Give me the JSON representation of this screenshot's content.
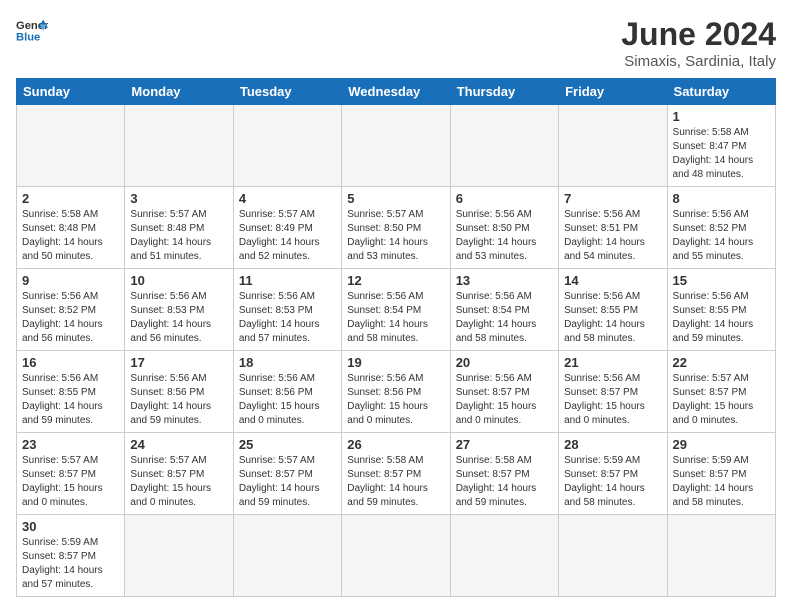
{
  "header": {
    "logo_general": "General",
    "logo_blue": "Blue",
    "month_title": "June 2024",
    "location": "Simaxis, Sardinia, Italy"
  },
  "days_of_week": [
    "Sunday",
    "Monday",
    "Tuesday",
    "Wednesday",
    "Thursday",
    "Friday",
    "Saturday"
  ],
  "weeks": [
    [
      {
        "day": null,
        "empty": true
      },
      {
        "day": null,
        "empty": true
      },
      {
        "day": null,
        "empty": true
      },
      {
        "day": null,
        "empty": true
      },
      {
        "day": null,
        "empty": true
      },
      {
        "day": null,
        "empty": true
      },
      {
        "day": 1,
        "sunrise": "5:58 AM",
        "sunset": "8:47 PM",
        "daylight": "14 hours and 48 minutes."
      }
    ],
    [
      {
        "day": 2,
        "sunrise": "5:58 AM",
        "sunset": "8:48 PM",
        "daylight": "14 hours and 50 minutes."
      },
      {
        "day": 3,
        "sunrise": "5:57 AM",
        "sunset": "8:48 PM",
        "daylight": "14 hours and 51 minutes."
      },
      {
        "day": 4,
        "sunrise": "5:57 AM",
        "sunset": "8:49 PM",
        "daylight": "14 hours and 52 minutes."
      },
      {
        "day": 5,
        "sunrise": "5:57 AM",
        "sunset": "8:50 PM",
        "daylight": "14 hours and 53 minutes."
      },
      {
        "day": 6,
        "sunrise": "5:56 AM",
        "sunset": "8:50 PM",
        "daylight": "14 hours and 53 minutes."
      },
      {
        "day": 7,
        "sunrise": "5:56 AM",
        "sunset": "8:51 PM",
        "daylight": "14 hours and 54 minutes."
      },
      {
        "day": 8,
        "sunrise": "5:56 AM",
        "sunset": "8:52 PM",
        "daylight": "14 hours and 55 minutes."
      }
    ],
    [
      {
        "day": 9,
        "sunrise": "5:56 AM",
        "sunset": "8:52 PM",
        "daylight": "14 hours and 56 minutes."
      },
      {
        "day": 10,
        "sunrise": "5:56 AM",
        "sunset": "8:53 PM",
        "daylight": "14 hours and 56 minutes."
      },
      {
        "day": 11,
        "sunrise": "5:56 AM",
        "sunset": "8:53 PM",
        "daylight": "14 hours and 57 minutes."
      },
      {
        "day": 12,
        "sunrise": "5:56 AM",
        "sunset": "8:54 PM",
        "daylight": "14 hours and 58 minutes."
      },
      {
        "day": 13,
        "sunrise": "5:56 AM",
        "sunset": "8:54 PM",
        "daylight": "14 hours and 58 minutes."
      },
      {
        "day": 14,
        "sunrise": "5:56 AM",
        "sunset": "8:55 PM",
        "daylight": "14 hours and 58 minutes."
      },
      {
        "day": 15,
        "sunrise": "5:56 AM",
        "sunset": "8:55 PM",
        "daylight": "14 hours and 59 minutes."
      }
    ],
    [
      {
        "day": 16,
        "sunrise": "5:56 AM",
        "sunset": "8:55 PM",
        "daylight": "14 hours and 59 minutes."
      },
      {
        "day": 17,
        "sunrise": "5:56 AM",
        "sunset": "8:56 PM",
        "daylight": "14 hours and 59 minutes."
      },
      {
        "day": 18,
        "sunrise": "5:56 AM",
        "sunset": "8:56 PM",
        "daylight": "15 hours and 0 minutes."
      },
      {
        "day": 19,
        "sunrise": "5:56 AM",
        "sunset": "8:56 PM",
        "daylight": "15 hours and 0 minutes."
      },
      {
        "day": 20,
        "sunrise": "5:56 AM",
        "sunset": "8:57 PM",
        "daylight": "15 hours and 0 minutes."
      },
      {
        "day": 21,
        "sunrise": "5:56 AM",
        "sunset": "8:57 PM",
        "daylight": "15 hours and 0 minutes."
      },
      {
        "day": 22,
        "sunrise": "5:57 AM",
        "sunset": "8:57 PM",
        "daylight": "15 hours and 0 minutes."
      }
    ],
    [
      {
        "day": 23,
        "sunrise": "5:57 AM",
        "sunset": "8:57 PM",
        "daylight": "15 hours and 0 minutes."
      },
      {
        "day": 24,
        "sunrise": "5:57 AM",
        "sunset": "8:57 PM",
        "daylight": "15 hours and 0 minutes."
      },
      {
        "day": 25,
        "sunrise": "5:57 AM",
        "sunset": "8:57 PM",
        "daylight": "14 hours and 59 minutes."
      },
      {
        "day": 26,
        "sunrise": "5:58 AM",
        "sunset": "8:57 PM",
        "daylight": "14 hours and 59 minutes."
      },
      {
        "day": 27,
        "sunrise": "5:58 AM",
        "sunset": "8:57 PM",
        "daylight": "14 hours and 59 minutes."
      },
      {
        "day": 28,
        "sunrise": "5:59 AM",
        "sunset": "8:57 PM",
        "daylight": "14 hours and 58 minutes."
      },
      {
        "day": 29,
        "sunrise": "5:59 AM",
        "sunset": "8:57 PM",
        "daylight": "14 hours and 58 minutes."
      }
    ],
    [
      {
        "day": 30,
        "sunrise": "5:59 AM",
        "sunset": "8:57 PM",
        "daylight": "14 hours and 57 minutes."
      },
      {
        "day": null,
        "empty": true
      },
      {
        "day": null,
        "empty": true
      },
      {
        "day": null,
        "empty": true
      },
      {
        "day": null,
        "empty": true
      },
      {
        "day": null,
        "empty": true
      },
      {
        "day": null,
        "empty": true
      }
    ]
  ]
}
